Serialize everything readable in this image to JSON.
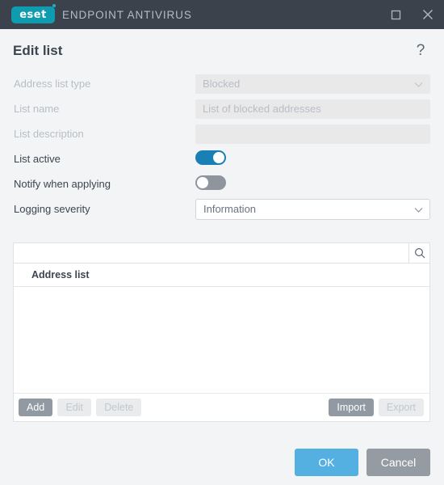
{
  "titlebar": {
    "logo_text": "eset",
    "product_name": "ENDPOINT ANTIVIRUS",
    "maximize_icon": "maximize-icon",
    "close_icon": "close-icon",
    "background_color": "#3b424b",
    "logo_color": "#0f9bb0"
  },
  "dialog": {
    "title": "Edit list",
    "help_label": "?"
  },
  "form": {
    "rows": [
      {
        "label": "Address list type",
        "type": "select-disabled",
        "value": "Blocked",
        "disabled": true
      },
      {
        "label": "List name",
        "type": "text-disabled",
        "value": "List of blocked addresses",
        "disabled": true
      },
      {
        "label": "List description",
        "type": "text-disabled",
        "value": "",
        "disabled": true
      },
      {
        "label": "List active",
        "type": "toggle",
        "value": "on",
        "disabled": false
      },
      {
        "label": "Notify when applying",
        "type": "toggle",
        "value": "off",
        "disabled": false
      },
      {
        "label": "Logging severity",
        "type": "select",
        "value": "Information",
        "disabled": false
      }
    ]
  },
  "search": {
    "value": "",
    "placeholder": "",
    "icon": "search-icon"
  },
  "table": {
    "column_header": "Address list",
    "rows": [],
    "buttons_left": [
      {
        "label": "Add",
        "enabled": true
      },
      {
        "label": "Edit",
        "enabled": false
      },
      {
        "label": "Delete",
        "enabled": false
      }
    ],
    "buttons_right": [
      {
        "label": "Import",
        "enabled": true
      },
      {
        "label": "Export",
        "enabled": false
      }
    ]
  },
  "footer": {
    "ok_label": "OK",
    "cancel_label": "Cancel",
    "ok_color": "#53b0e0",
    "cancel_color": "#949ba2"
  }
}
